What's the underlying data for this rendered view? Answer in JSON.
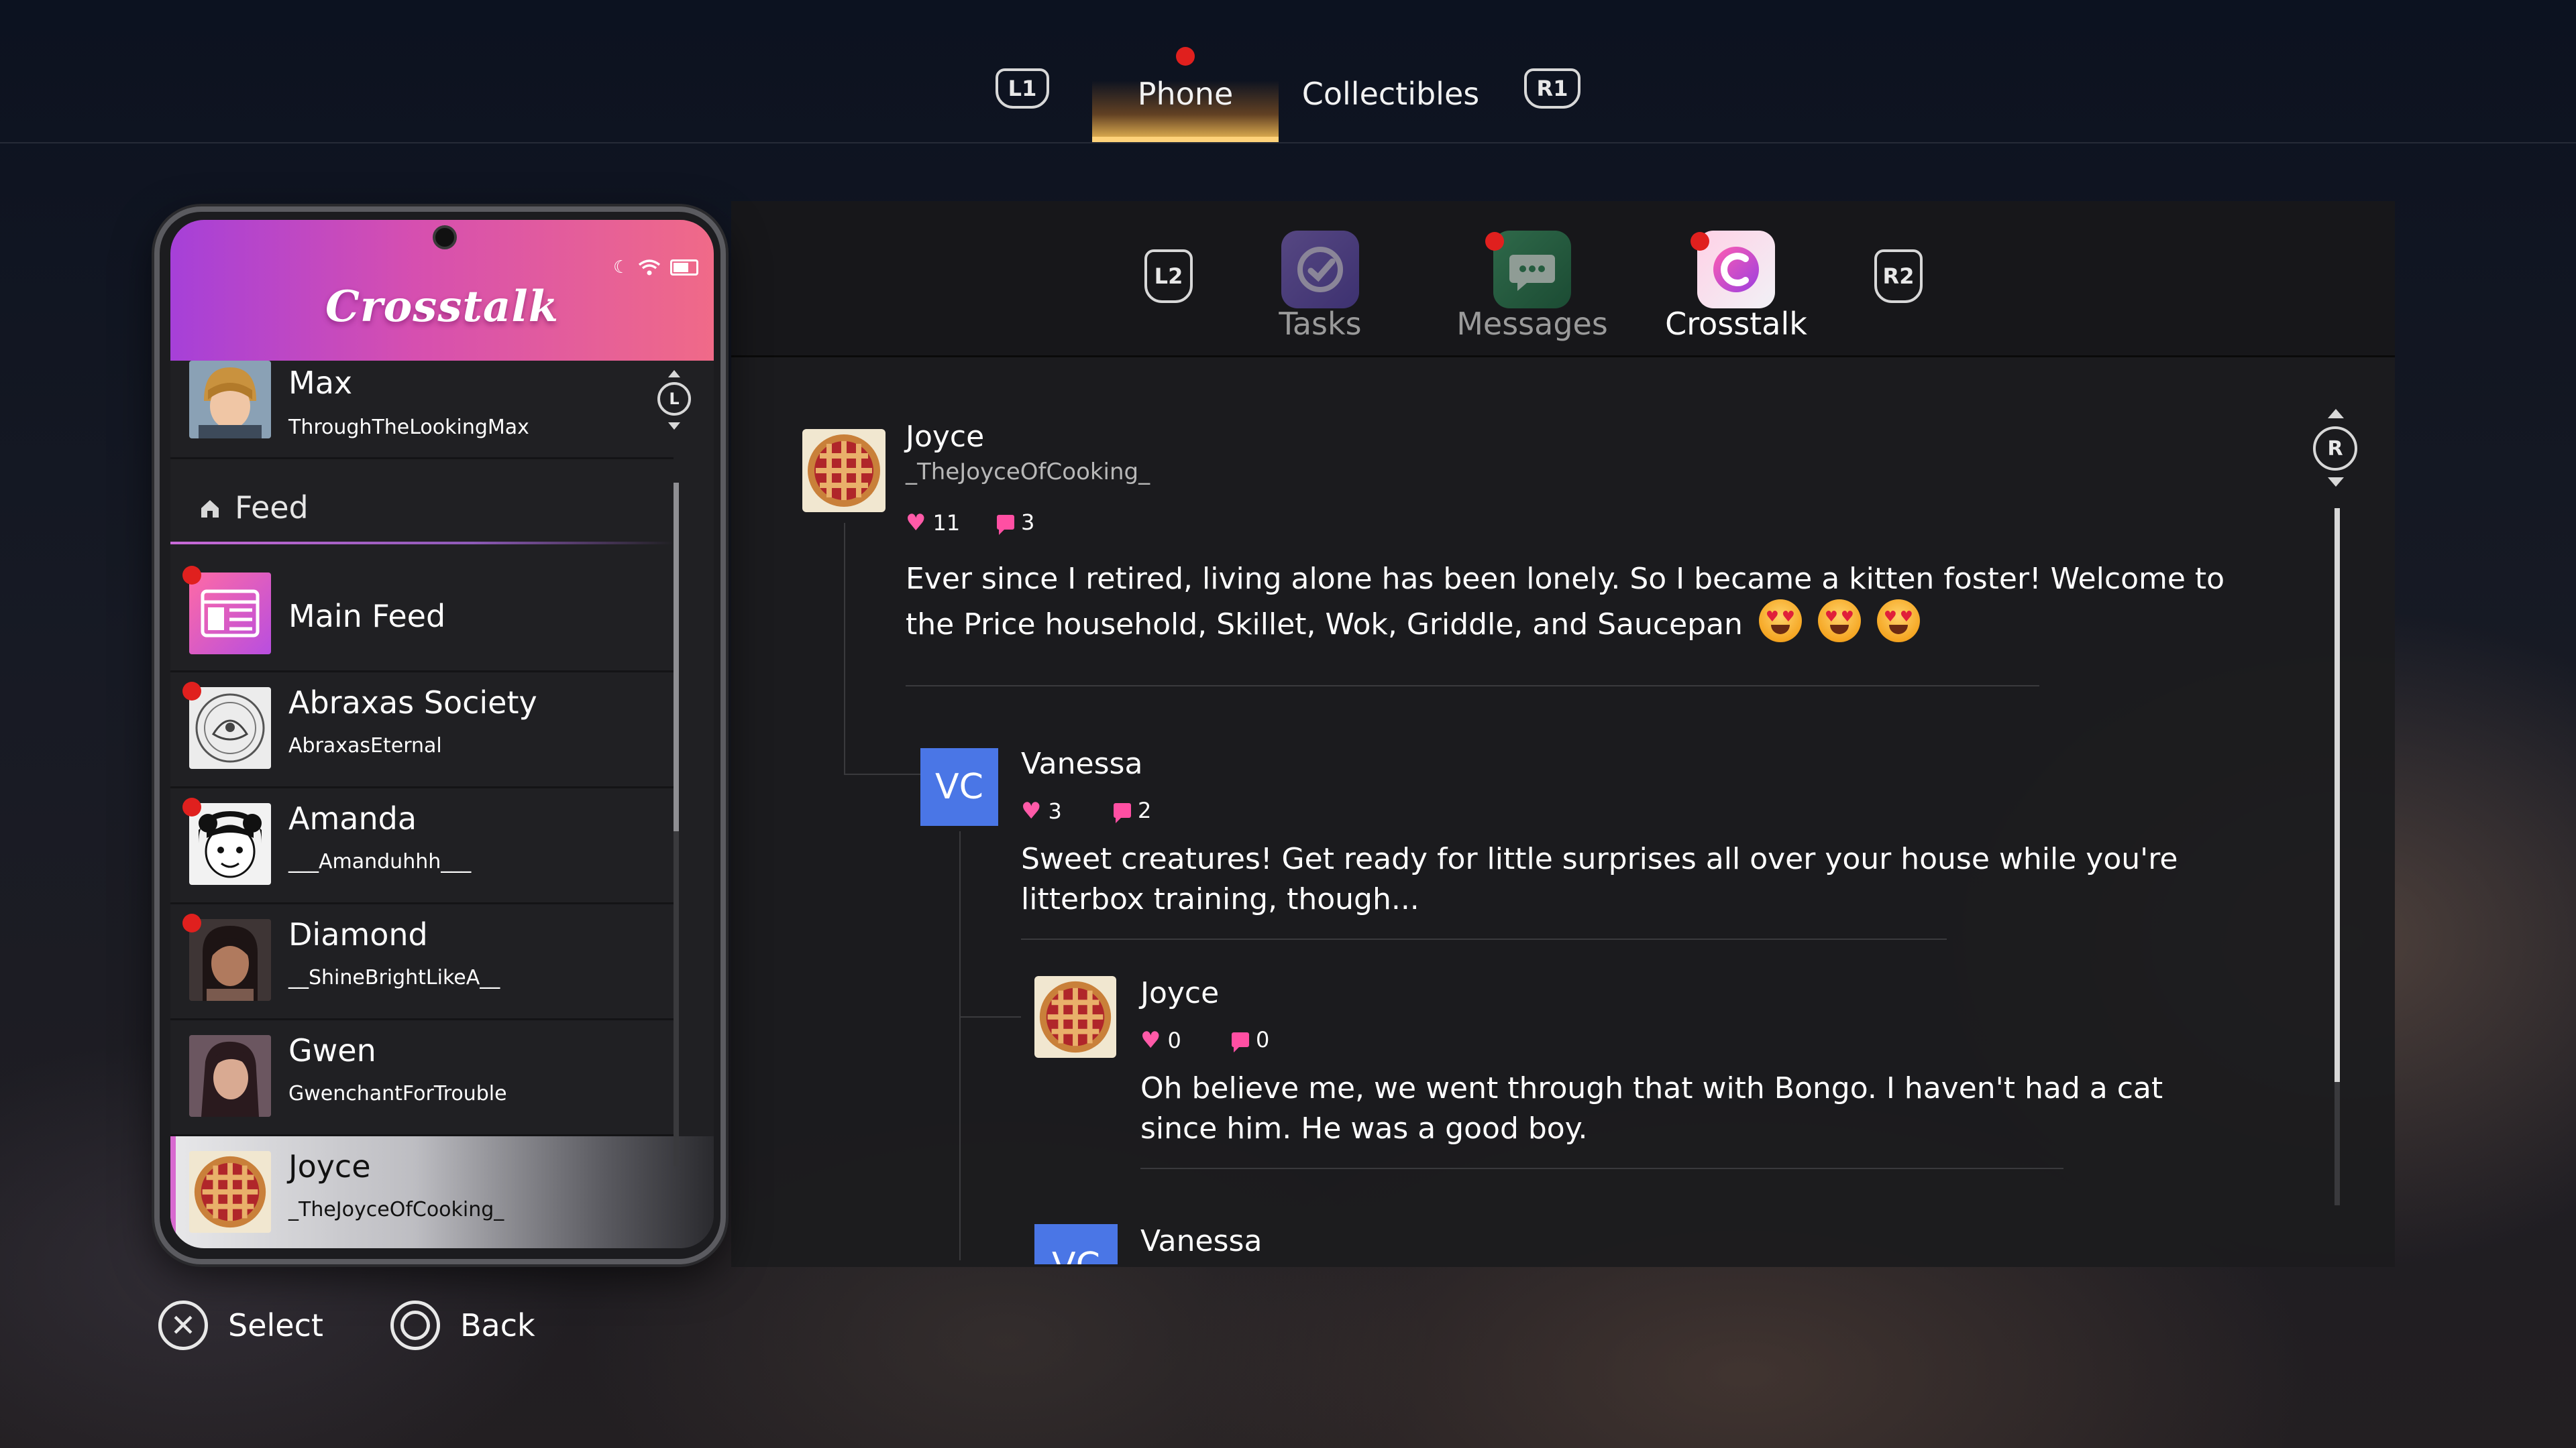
{
  "top_nav": {
    "l1": "L1",
    "r1": "R1",
    "tabs": [
      {
        "label": "Phone",
        "active": true,
        "notification": true
      },
      {
        "label": "Collectibles",
        "active": false,
        "notification": false
      }
    ]
  },
  "phone": {
    "app_title": "Crosstalk",
    "scroll_hint": "L",
    "profile": {
      "name": "Max",
      "handle": "ThroughTheLookingMax"
    },
    "section_label": "Feed",
    "contacts": [
      {
        "name": "Main Feed",
        "handle": "",
        "notification": true,
        "avatar": "feed-icon"
      },
      {
        "name": "Abraxas Society",
        "handle": "AbraxasEternal",
        "notification": true,
        "avatar": "abraxas-sketch"
      },
      {
        "name": "Amanda",
        "handle": "___Amanduhhh___",
        "notification": true,
        "avatar": "amanda-sketch"
      },
      {
        "name": "Diamond",
        "handle": "__ShineBrightLikeA__",
        "notification": true,
        "avatar": "diamond-photo"
      },
      {
        "name": "Gwen",
        "handle": "GwenchantForTrouble",
        "notification": false,
        "avatar": "gwen-photo"
      },
      {
        "name": "Joyce",
        "handle": "_TheJoyceOfCooking_",
        "notification": false,
        "avatar": "pie",
        "selected": true
      }
    ]
  },
  "app_bar": {
    "l2": "L2",
    "r2": "R2",
    "apps": [
      {
        "label": "Tasks",
        "notification": false,
        "active": false
      },
      {
        "label": "Messages",
        "notification": true,
        "active": false
      },
      {
        "label": "Crosstalk",
        "notification": true,
        "active": true
      }
    ]
  },
  "feed": {
    "scroll_hint": "R",
    "post": {
      "author": "Joyce",
      "handle": "_TheJoyceOfCooking_",
      "likes": "11",
      "comments": "3",
      "text": "Ever since I retired, living alone has been lonely. So I became a kitten foster! Welcome to the Price household, Skillet, Wok, Griddle, and Saucepan",
      "emoji": "heart-eyes"
    },
    "replies": [
      {
        "author": "Vanessa",
        "initials": "VC",
        "likes": "3",
        "comments": "2",
        "text": "Sweet creatures! Get ready for little surprises all over your house while you're litterbox training, though..."
      },
      {
        "author": "Joyce",
        "likes": "0",
        "comments": "0",
        "text": "Oh believe me, we went through that with Bongo. I haven't had a cat since him. He was a good boy."
      },
      {
        "author": "Vanessa",
        "initials": "VC"
      }
    ]
  },
  "prompts": {
    "select": "Select",
    "back": "Back"
  },
  "colors": {
    "accent_orange": "#ffb347",
    "crosstalk_pink": "#f06a88",
    "crosstalk_purple": "#a640d8",
    "notification_red": "#e0201e",
    "vc_blue": "#4a76e6",
    "heart_pink": "#ff5aa8"
  }
}
